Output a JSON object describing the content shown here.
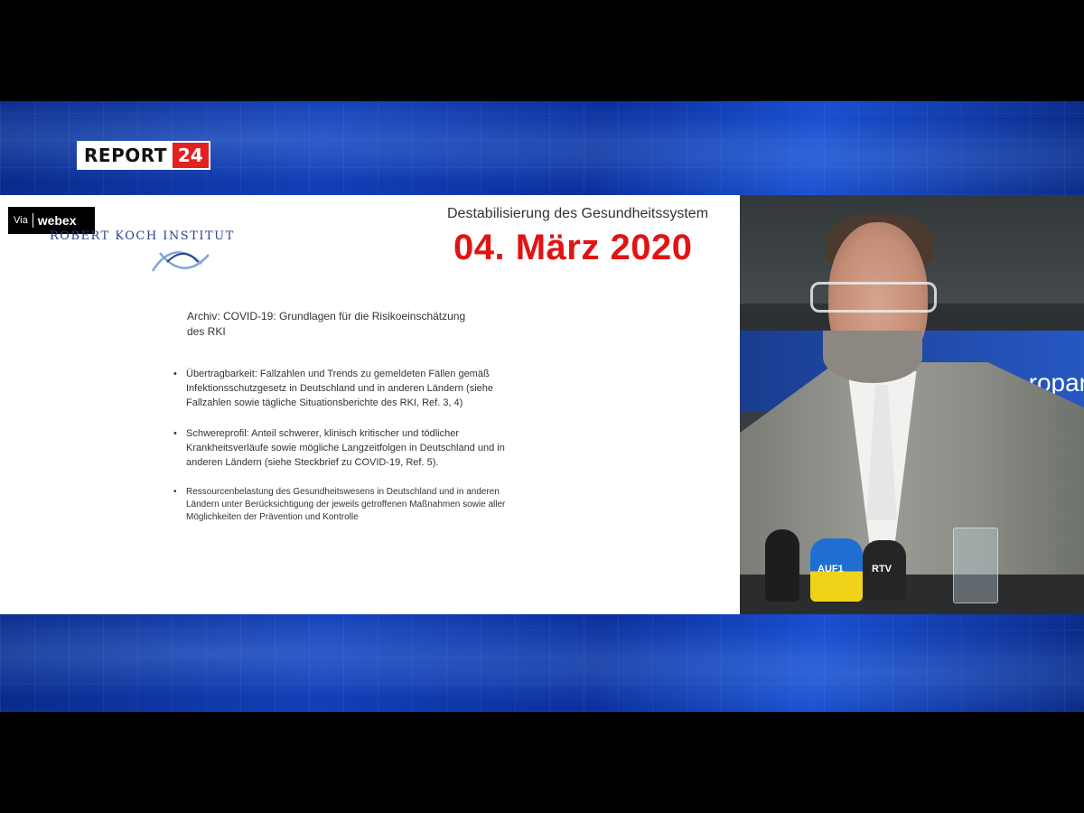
{
  "broadcast": {
    "logo_word": "REPORT",
    "logo_number": "24"
  },
  "slide": {
    "webex_via": "Via",
    "webex_brand": "webex",
    "institute_name": "ROBERT KOCH INSTITUT",
    "title": "Destabilisierung des Gesundheitssystem",
    "date": "04. März 2020",
    "doc_title": "Archiv: COVID-19: Grundlagen für die Risikoeinschätzung des RKI",
    "bullets": [
      "Übertragbarkeit: Fallzahlen und Trends zu gemeldeten Fällen gemäß Infektionsschutzgesetz in Deutschland und in anderen Ländern (siehe Fallzahlen sowie tägliche Situationsberichte des RKI, Ref. 3, 4)",
      "Schwereprofil: Anteil schwerer, klinisch kritischer und tödlicher Krankheitsverläufe sowie mögliche Langzeitfolgen in Deutschland und in anderen Ländern (siehe Steckbrief zu COVID-19, Ref. 5).",
      "Ressourcenbelastung des Gesundheitswesens in Deutschland und in anderen Ländern unter Berücksichtigung der jeweils getroffenen Maßnahmen sowie aller Möglichkeiten der Prävention und Kontrolle"
    ]
  },
  "video": {
    "background_sign": "ropar",
    "mic_labels": [
      "AUF1",
      "RTV"
    ]
  },
  "colors": {
    "date_red": "#e01414",
    "logo_red": "#e32020",
    "band_blue": "#123fb8",
    "institute_blue": "#2a3f8c"
  }
}
